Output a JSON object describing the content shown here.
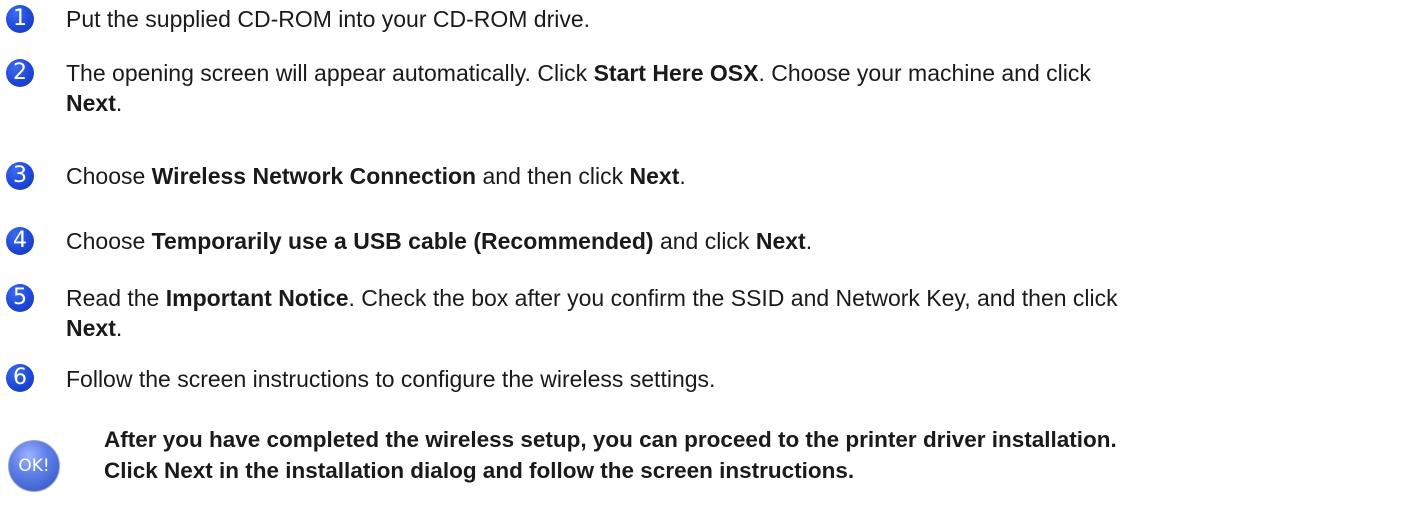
{
  "steps": [
    {
      "number": "1",
      "parts": [
        "Put the supplied CD-ROM into your CD-ROM drive."
      ]
    },
    {
      "number": "2",
      "parts": [
        "The opening screen will appear automatically. Click ",
        "Start Here OSX",
        ". Choose your machine and click ",
        "Next",
        "."
      ]
    },
    {
      "number": "3",
      "parts": [
        "Choose ",
        "Wireless Network Connection",
        " and then click ",
        "Next",
        "."
      ]
    },
    {
      "number": "4",
      "parts": [
        "Choose ",
        "Temporarily use a USB cable (Recommended)",
        " and click ",
        "Next",
        "."
      ]
    },
    {
      "number": "5",
      "parts": [
        "Read the ",
        "Important Notice",
        ". Check the box after you confirm the SSID and Network Key, and then click ",
        "Next",
        "."
      ]
    },
    {
      "number": "6",
      "parts": [
        "Follow the screen instructions to configure the wireless settings."
      ]
    }
  ],
  "ok_note": {
    "icon_label": "OK!",
    "line1": "After you have completed the wireless setup, you can proceed to the printer driver installation.",
    "line2": "Click Next in the installation dialog and follow the screen instructions."
  },
  "colors": {
    "step_badge": "#1f47d6",
    "text": "#1a1a1a",
    "ok_icon": "#5f7fe8"
  }
}
